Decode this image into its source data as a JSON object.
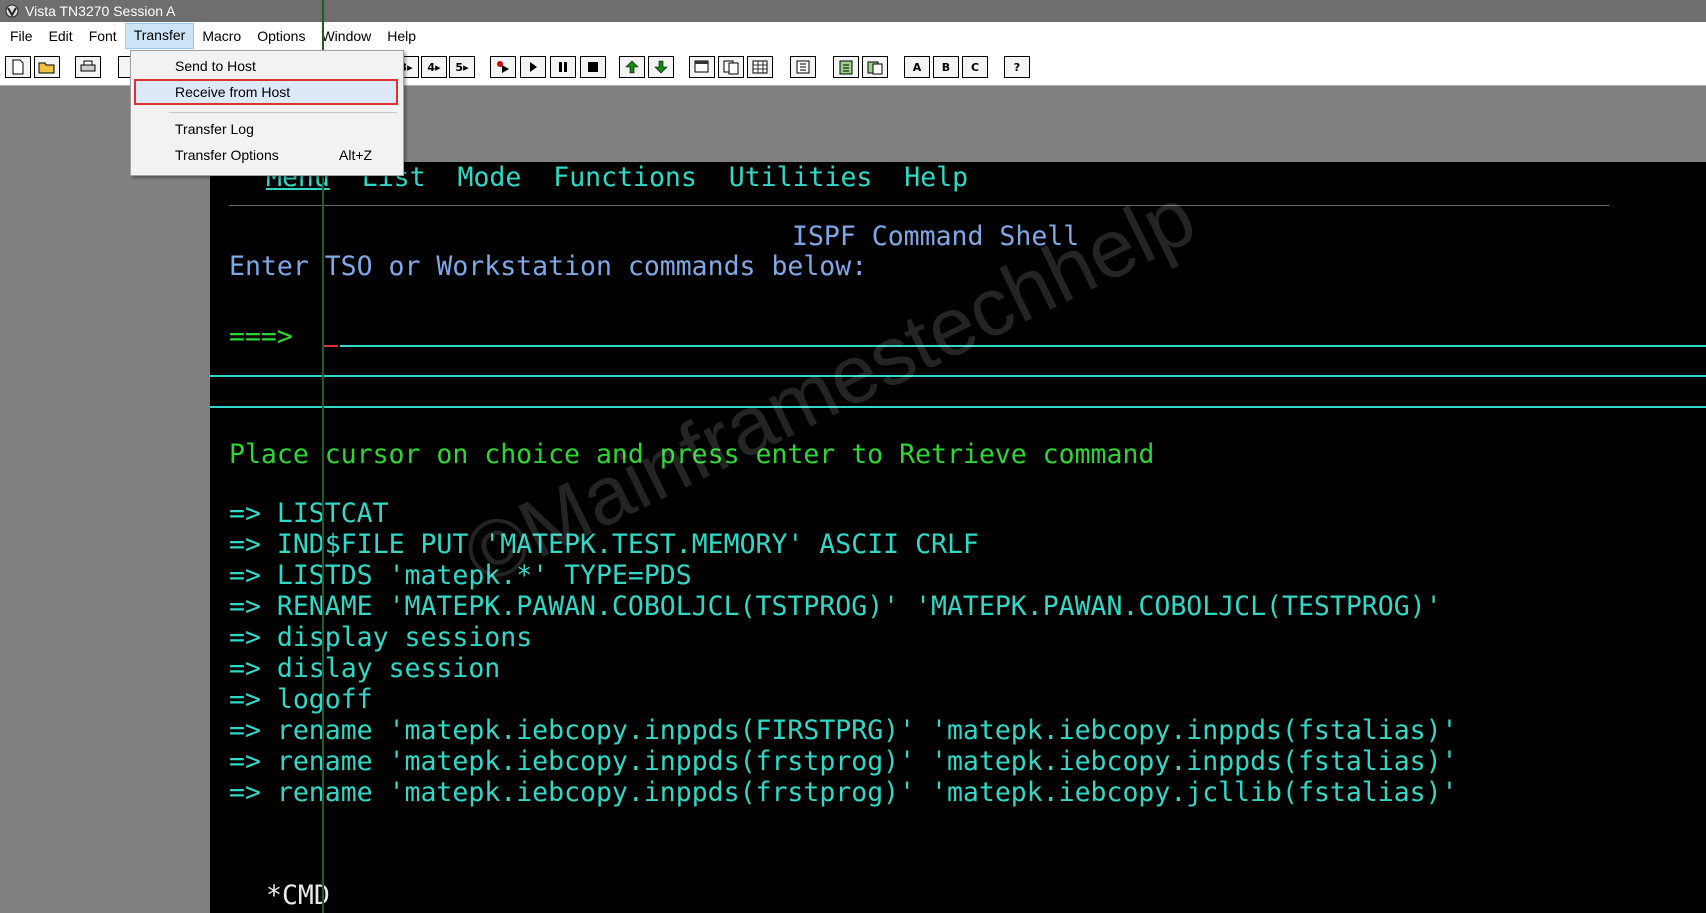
{
  "window": {
    "title": "Vista TN3270 Session A"
  },
  "menubar": [
    {
      "label": "File"
    },
    {
      "label": "Edit"
    },
    {
      "label": "Font"
    },
    {
      "label": "Transfer",
      "active": true
    },
    {
      "label": "Macro"
    },
    {
      "label": "Options"
    },
    {
      "label": "Window"
    },
    {
      "label": "Help"
    }
  ],
  "transfer_menu": {
    "send": "Send to Host",
    "receive": "Receive from Host",
    "log": "Transfer Log",
    "options": "Transfer Options",
    "options_shortcut": "Alt+Z"
  },
  "toolbar": {
    "session_buttons": [
      "3",
      "4",
      "5"
    ],
    "letter_buttons": [
      "A",
      "B",
      "C"
    ],
    "help_button": "?"
  },
  "ispf": {
    "action_bar": [
      "Menu",
      "List",
      "Mode",
      "Functions",
      "Utilities",
      "Help"
    ],
    "title": "ISPF Command Shell",
    "instruction": "Enter TSO or Workstation commands below:",
    "prompt": "===>",
    "retrieve_hint": "Place cursor on choice and press enter to Retrieve command",
    "command_prefix": "=>",
    "commands": [
      "LISTCAT",
      "IND$FILE PUT 'MATEPK.TEST.MEMORY' ASCII CRLF",
      "LISTDS 'matepk.*' TYPE=PDS",
      "RENAME 'MATEPK.PAWAN.COBOLJCL(TSTPROG)' 'MATEPK.PAWAN.COBOLJCL(TESTPROG)'",
      "display sessions",
      "dislay session",
      "logoff",
      "rename 'matepk.iebcopy.inppds(FIRSTPRG)' 'matepk.iebcopy.inppds(fstalias)'",
      "rename 'matepk.iebcopy.inppds(frstprog)' 'matepk.iebcopy.inppds(fstalias)'",
      "rename 'matepk.iebcopy.inppds(frstprog)' 'matepk.iebcopy.jcllib(fstalias)'"
    ],
    "footer": "*CMD"
  },
  "watermark": "©Mainframestechhelp",
  "colors": {
    "terminal_bg": "#000000",
    "cyan": "#31d8c8",
    "blue": "#7fa8e6",
    "green": "#2cd634",
    "highlight_border": "#e03030"
  }
}
